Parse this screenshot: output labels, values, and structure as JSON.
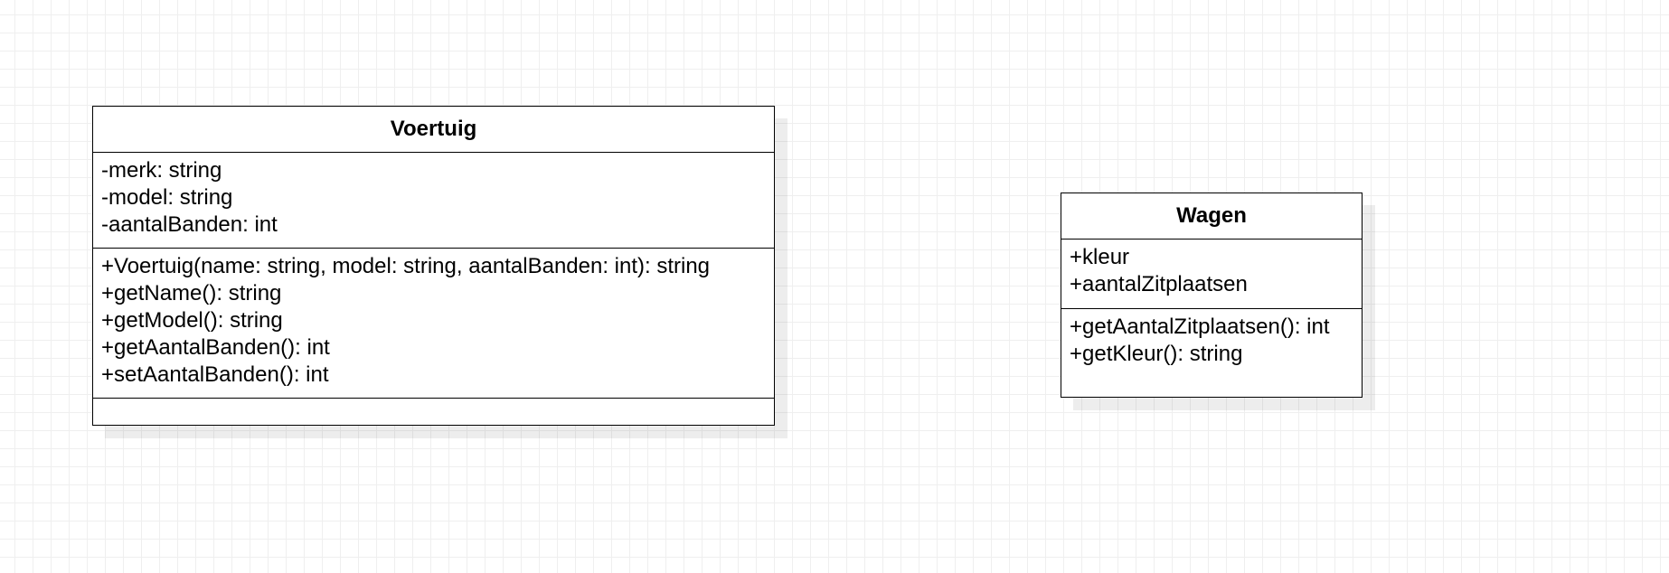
{
  "classes": {
    "voertuig": {
      "name": "Voertuig",
      "attributes": [
        "-merk: string",
        "-model: string",
        "-aantalBanden: int"
      ],
      "methods": [
        "+Voertuig(name: string, model: string, aantalBanden: int): string",
        "+getName(): string",
        "+getModel(): string",
        "+getAantalBanden(): int",
        "+setAantalBanden(): int"
      ]
    },
    "wagen": {
      "name": "Wagen",
      "attributes": [
        "+kleur",
        "+aantalZitplaatsen"
      ],
      "methods": [
        "+getAantalZitplaatsen(): int",
        "+getKleur(): string"
      ]
    }
  }
}
